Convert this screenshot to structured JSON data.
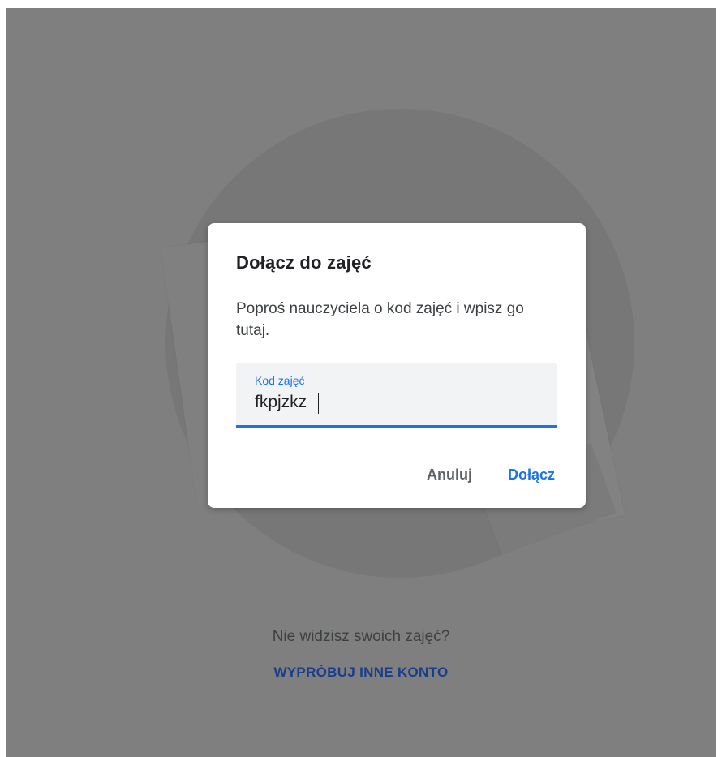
{
  "dialog": {
    "title": "Dołącz do zajęć",
    "description": "Poproś nauczyciela o kod zajęć i wpisz go tutaj.",
    "field": {
      "label": "Kod zajęć",
      "value": "fkpjzkz"
    },
    "buttons": {
      "cancel_label": "Anuluj",
      "join_label": "Dołącz"
    }
  },
  "footer": {
    "prompt": "Nie widzisz swoich zajęć?",
    "switch_account_label": "WYPRÓBUJ INNE KONTO"
  },
  "colors": {
    "accent": "#1a73e8",
    "overlay": "#7f7f7f",
    "link": "#1a3c8c"
  }
}
